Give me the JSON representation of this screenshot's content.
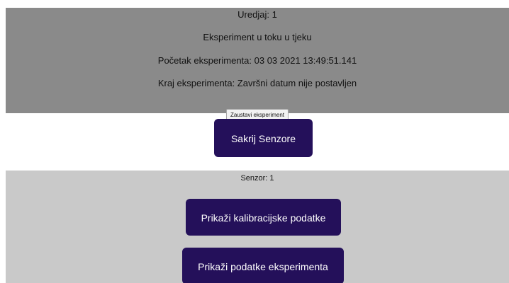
{
  "device_panel": {
    "device_label": "Uredjaj: 1",
    "status_label": "Eksperiment u toku u tjeku",
    "start_label": "Početak eksperimenta: 03 03 2021 13:49:51.141",
    "end_label": "Kraj eksperimenta: Završni datum nije postavljen",
    "stop_button_label": "Zaustavi eksperiment"
  },
  "hide_sensors_button_label": "Sakrij Senzore",
  "sensor_panel": {
    "sensor_label": "Senzor: 1",
    "calibration_button_label": "Prikaži kalibracijske podatke",
    "experiment_data_button_label": "Prikaži podatke eksperimenta"
  },
  "colors": {
    "device_panel_background": "#8a8a8a",
    "sensor_panel_background": "#c9c9c9",
    "button_background": "#24105a",
    "button_text": "#ffffff",
    "stop_button_background": "#f2f2f2"
  }
}
